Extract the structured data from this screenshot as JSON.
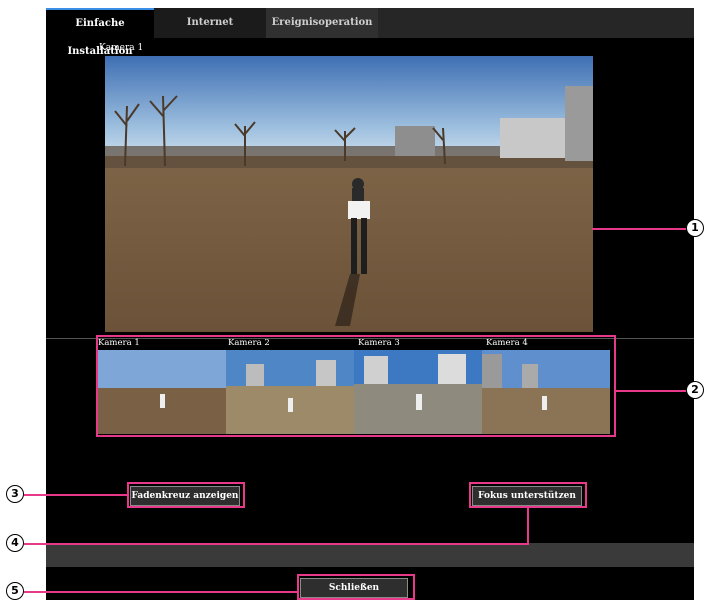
{
  "tabs": [
    {
      "label": "Einfache Installation"
    },
    {
      "label": "Internet"
    },
    {
      "label": "Ereignisoperation"
    }
  ],
  "main_camera": {
    "label": "Kamera 1"
  },
  "thumbnails": [
    {
      "label": "Kamera 1"
    },
    {
      "label": "Kamera 2"
    },
    {
      "label": "Kamera 3"
    },
    {
      "label": "Kamera 4"
    }
  ],
  "buttons": {
    "crosshair": "Fadenkreuz anzeigen",
    "focus": "Fokus unterstützen",
    "close": "Schließen"
  },
  "callouts": [
    "1",
    "2",
    "3",
    "4",
    "5"
  ],
  "colors": {
    "callout": "#e8388a",
    "tab_active_border": "#3a8ee6"
  }
}
